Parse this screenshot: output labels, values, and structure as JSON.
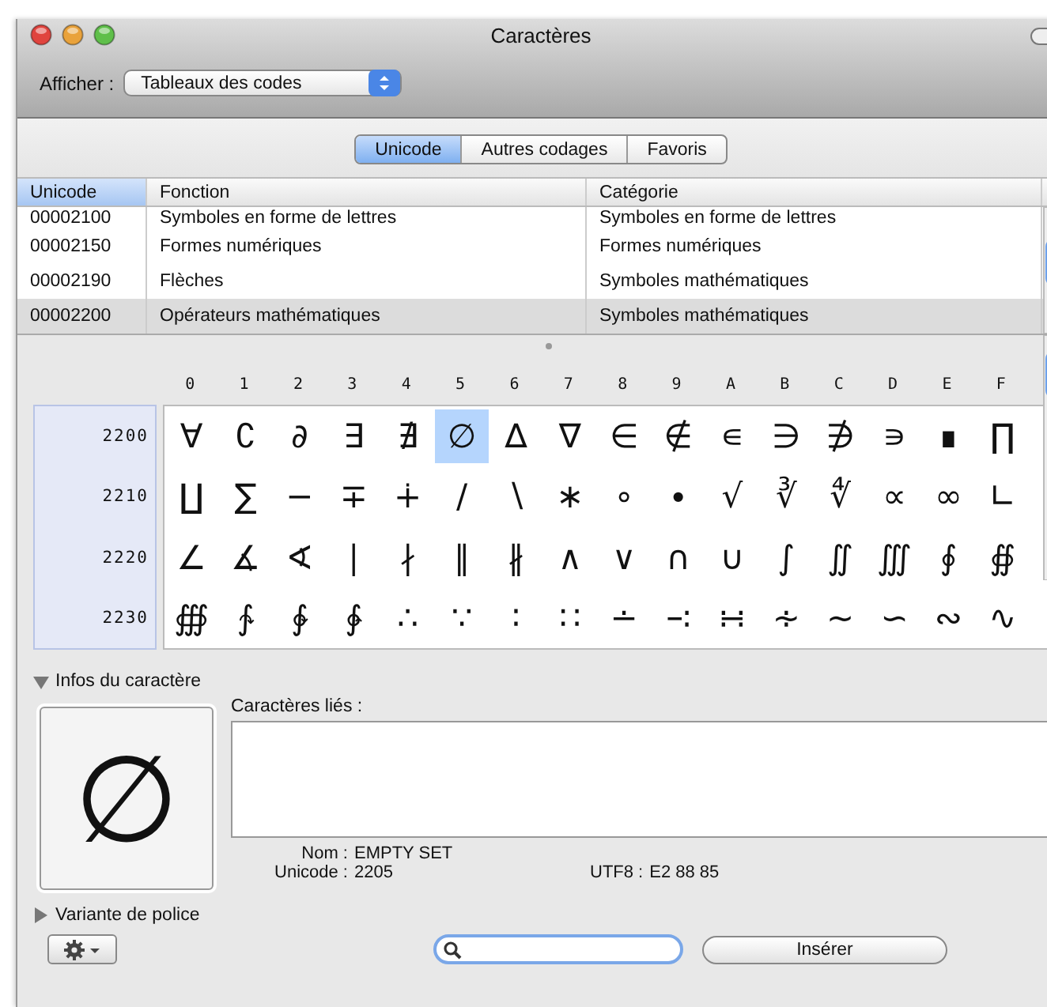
{
  "window": {
    "title": "Caractères"
  },
  "toolbar": {
    "show_label": "Afficher :",
    "show_value": "Tableaux des codes"
  },
  "tabs": [
    {
      "label": "Unicode",
      "selected": true
    },
    {
      "label": "Autres codages",
      "selected": false
    },
    {
      "label": "Favoris",
      "selected": false
    }
  ],
  "blocks": {
    "columns": [
      {
        "label": "Unicode",
        "selected": true
      },
      {
        "label": "Fonction",
        "selected": false
      },
      {
        "label": "Catégorie",
        "selected": false
      }
    ],
    "rows": [
      {
        "code": "00002100",
        "function": "Symboles en forme de lettres",
        "category": "Symboles en forme de lettres",
        "selected": false
      },
      {
        "code": "00002150",
        "function": "Formes numériques",
        "category": "Formes numériques",
        "selected": false
      },
      {
        "code": "00002190",
        "function": "Flèches",
        "category": "Symboles mathématiques",
        "selected": false
      },
      {
        "code": "00002200",
        "function": "Opérateurs mathématiques",
        "category": "Symboles mathématiques",
        "selected": true
      }
    ]
  },
  "grid": {
    "columns": [
      "0",
      "1",
      "2",
      "3",
      "4",
      "5",
      "6",
      "7",
      "8",
      "9",
      "A",
      "B",
      "C",
      "D",
      "E",
      "F"
    ],
    "rows": [
      {
        "label": "2200",
        "cells": [
          {
            "char": "∀",
            "selected": false
          },
          {
            "char": "∁",
            "selected": false
          },
          {
            "char": "∂",
            "selected": false
          },
          {
            "char": "∃",
            "selected": false
          },
          {
            "char": "∄",
            "selected": false
          },
          {
            "char": "∅",
            "selected": true
          },
          {
            "char": "∆",
            "selected": false
          },
          {
            "char": "∇",
            "selected": false
          },
          {
            "char": "∈",
            "selected": false
          },
          {
            "char": "∉",
            "selected": false
          },
          {
            "char": "∊",
            "selected": false
          },
          {
            "char": "∋",
            "selected": false
          },
          {
            "char": "∌",
            "selected": false
          },
          {
            "char": "∍",
            "selected": false
          },
          {
            "char": "∎",
            "selected": false
          },
          {
            "char": "∏",
            "selected": false
          }
        ]
      },
      {
        "label": "2210",
        "cells": [
          {
            "char": "∐",
            "selected": false
          },
          {
            "char": "∑",
            "selected": false
          },
          {
            "char": "−",
            "selected": false
          },
          {
            "char": "∓",
            "selected": false
          },
          {
            "char": "∔",
            "selected": false
          },
          {
            "char": "∕",
            "selected": false
          },
          {
            "char": "∖",
            "selected": false
          },
          {
            "char": "∗",
            "selected": false
          },
          {
            "char": "∘",
            "selected": false
          },
          {
            "char": "∙",
            "selected": false
          },
          {
            "char": "√",
            "selected": false
          },
          {
            "char": "∛",
            "selected": false
          },
          {
            "char": "∜",
            "selected": false
          },
          {
            "char": "∝",
            "selected": false
          },
          {
            "char": "∞",
            "selected": false
          },
          {
            "char": "∟",
            "selected": false
          }
        ]
      },
      {
        "label": "2220",
        "cells": [
          {
            "char": "∠",
            "selected": false
          },
          {
            "char": "∡",
            "selected": false
          },
          {
            "char": "∢",
            "selected": false
          },
          {
            "char": "∣",
            "selected": false
          },
          {
            "char": "∤",
            "selected": false
          },
          {
            "char": "∥",
            "selected": false
          },
          {
            "char": "∦",
            "selected": false
          },
          {
            "char": "∧",
            "selected": false
          },
          {
            "char": "∨",
            "selected": false
          },
          {
            "char": "∩",
            "selected": false
          },
          {
            "char": "∪",
            "selected": false
          },
          {
            "char": "∫",
            "selected": false
          },
          {
            "char": "∬",
            "selected": false
          },
          {
            "char": "∭",
            "selected": false
          },
          {
            "char": "∮",
            "selected": false
          },
          {
            "char": "∯",
            "selected": false
          }
        ]
      },
      {
        "label": "2230",
        "cells": [
          {
            "char": "∰",
            "selected": false
          },
          {
            "char": "∱",
            "selected": false
          },
          {
            "char": "∲",
            "selected": false
          },
          {
            "char": "∳",
            "selected": false
          },
          {
            "char": "∴",
            "selected": false
          },
          {
            "char": "∵",
            "selected": false
          },
          {
            "char": "∶",
            "selected": false
          },
          {
            "char": "∷",
            "selected": false
          },
          {
            "char": "∸",
            "selected": false
          },
          {
            "char": "∹",
            "selected": false
          },
          {
            "char": "∺",
            "selected": false
          },
          {
            "char": "∻",
            "selected": false
          },
          {
            "char": "∼",
            "selected": false
          },
          {
            "char": "∽",
            "selected": false
          },
          {
            "char": "∾",
            "selected": false
          },
          {
            "char": "∿",
            "selected": false
          }
        ]
      }
    ]
  },
  "info": {
    "title": "Infos du caractère",
    "expanded": true,
    "preview": "∅",
    "related_label": "Caractères liés :",
    "fields": [
      {
        "label": "Nom :",
        "value": "EMPTY SET"
      },
      {
        "label": "Unicode :",
        "value": "2205"
      },
      {
        "label": "UTF8 :",
        "value": "E2 88 85"
      }
    ]
  },
  "font_variant": {
    "title": "Variante de police",
    "expanded": false
  },
  "bottom": {
    "insert_button": "Insérer"
  }
}
